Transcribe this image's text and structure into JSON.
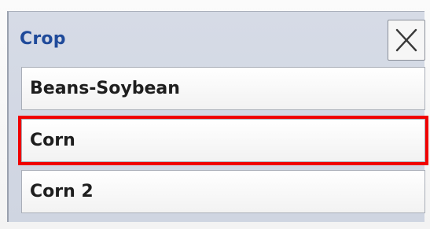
{
  "dialog": {
    "title": "Crop",
    "close_icon": "close-icon"
  },
  "list": {
    "items": [
      {
        "label": "Beans-Soybean",
        "selected": false
      },
      {
        "label": "Corn",
        "selected": true
      },
      {
        "label": "Corn 2",
        "selected": false
      }
    ]
  },
  "colors": {
    "title": "#1f4a9a",
    "highlight": "#f00000",
    "dialog_background": "#d3d8e3"
  }
}
